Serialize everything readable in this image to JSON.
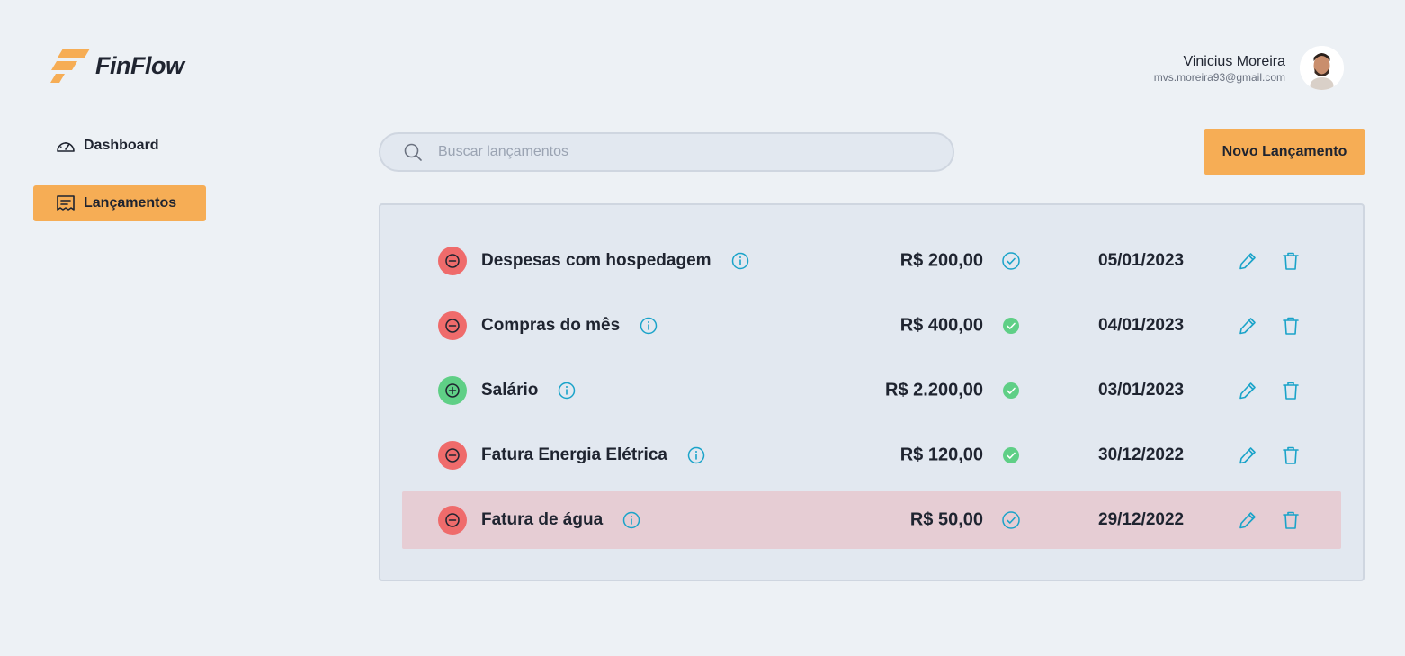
{
  "app": {
    "name": "FinFlow",
    "brand_color": "#f6ad55"
  },
  "user": {
    "name": "Vinicius Moreira",
    "email": "mvs.moreira93@gmail.com"
  },
  "sidebar": {
    "items": [
      {
        "label": "Dashboard",
        "icon": "gauge-icon",
        "active": false
      },
      {
        "label": "Lançamentos",
        "icon": "receipt-icon",
        "active": true
      }
    ]
  },
  "search": {
    "placeholder": "Buscar lançamentos",
    "value": ""
  },
  "toolbar": {
    "new_label": "Novo Lançamento"
  },
  "colors": {
    "expense": "#ef6b6b",
    "income": "#5fcf86",
    "action": "#1aa3c9",
    "highlight": "#e6cdd4"
  },
  "entries": [
    {
      "type": "expense",
      "description": "Despesas com hospedagem",
      "amount": "R$ 200,00",
      "paid": false,
      "date": "05/01/2023"
    },
    {
      "type": "expense",
      "description": "Compras do mês",
      "amount": "R$ 400,00",
      "paid": true,
      "date": "04/01/2023"
    },
    {
      "type": "income",
      "description": "Salário",
      "amount": "R$ 2.200,00",
      "paid": true,
      "date": "03/01/2023"
    },
    {
      "type": "expense",
      "description": "Fatura Energia Elétrica",
      "amount": "R$ 120,00",
      "paid": true,
      "date": "30/12/2022"
    },
    {
      "type": "expense",
      "description": "Fatura de água",
      "amount": "R$ 50,00",
      "paid": false,
      "date": "29/12/2022",
      "highlighted": true
    }
  ]
}
